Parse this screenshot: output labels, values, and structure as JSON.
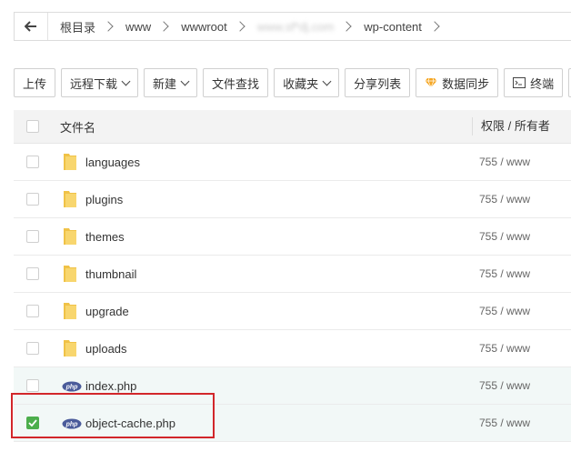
{
  "breadcrumb": {
    "items": [
      "根目录",
      "www",
      "wwwroot",
      "www.sf*dj.com",
      "wp-content"
    ]
  },
  "toolbar": {
    "upload": "上传",
    "remote_download": "远程下载",
    "new": "新建",
    "file_search": "文件查找",
    "favorites": "收藏夹",
    "share_list": "分享列表",
    "data_sync": "数据同步",
    "terminal": "终端"
  },
  "table": {
    "col_name": "文件名",
    "col_perm": "权限 / 所有者",
    "rows": [
      {
        "name": "languages",
        "perm": "755 / www",
        "type": "folder",
        "checked": false
      },
      {
        "name": "plugins",
        "perm": "755 / www",
        "type": "folder",
        "checked": false
      },
      {
        "name": "themes",
        "perm": "755 / www",
        "type": "folder",
        "checked": false
      },
      {
        "name": "thumbnail",
        "perm": "755 / www",
        "type": "folder",
        "checked": false
      },
      {
        "name": "upgrade",
        "perm": "755 / www",
        "type": "folder",
        "checked": false
      },
      {
        "name": "uploads",
        "perm": "755 / www",
        "type": "folder",
        "checked": false
      },
      {
        "name": "index.php",
        "perm": "755 / www",
        "type": "php",
        "checked": false
      },
      {
        "name": "object-cache.php",
        "perm": "755 / www",
        "type": "php",
        "checked": true
      }
    ]
  },
  "icons": {
    "php_badge": "php"
  },
  "colors": {
    "check_green": "#4cae4c",
    "highlight_red": "#d2262a",
    "folder_yellow": "#f7d46a"
  }
}
